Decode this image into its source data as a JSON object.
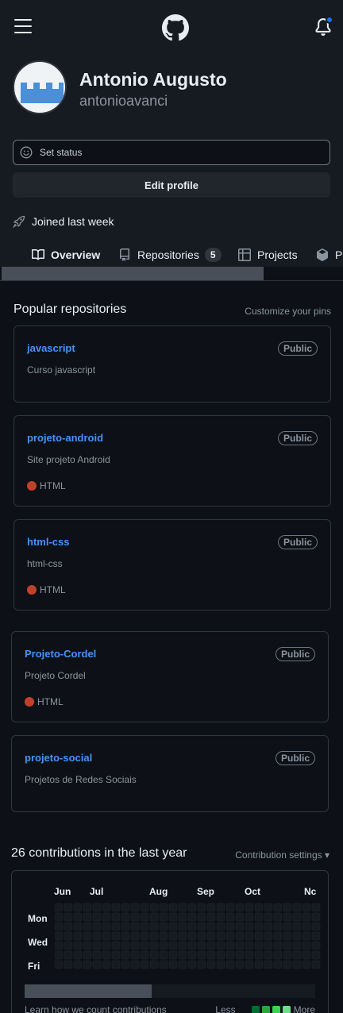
{
  "header": {
    "logo_icon": "github-mark-icon",
    "menu_icon": "hamburger-icon",
    "notification_icon": "bell-icon"
  },
  "profile": {
    "name": "Antonio Augusto",
    "login": "antonioavanci",
    "set_status": "Set status",
    "edit_profile": "Edit profile",
    "joined": "Joined last week"
  },
  "tabs": [
    {
      "label": "Overview",
      "icon": "book-icon",
      "active": true
    },
    {
      "label": "Repositories",
      "icon": "repo-icon",
      "count": "5"
    },
    {
      "label": "Projects",
      "icon": "table-icon"
    },
    {
      "label": "Pa",
      "icon": "package-icon"
    }
  ],
  "popular": {
    "title": "Popular repositories",
    "customize": "Customize your pins",
    "repos": [
      {
        "name": "javascript",
        "badge": "Public",
        "description": "Curso javascript"
      },
      {
        "name": "projeto-android",
        "badge": "Public",
        "description": "Site projeto Android",
        "language": "HTML",
        "language_color": "#e34c26"
      },
      {
        "name": "html-css",
        "badge": "Public",
        "description": "html-css",
        "language": "HTML",
        "language_color": "#e34c26"
      },
      {
        "name": "Projeto-Cordel",
        "badge": "Public",
        "description": "Projeto Cordel",
        "language": "HTML",
        "language_color": "#e34c26"
      },
      {
        "name": "projeto-social",
        "badge": "Public",
        "description": "Projetos de Redes Sociais"
      }
    ]
  },
  "contributions": {
    "title": "26 contributions in the last year",
    "settings": "Contribution settings ▾",
    "months": [
      "Jun",
      "Jul",
      "Aug",
      "Sep",
      "Oct",
      "Nc"
    ],
    "days": [
      "Mon",
      "Wed",
      "Fri"
    ],
    "learn": "Learn how we count contributions",
    "less": "Less",
    "more": "More",
    "legend_colors": [
      "#161b22",
      "#0e4429",
      "#006d32",
      "#26a641",
      "#39d353"
    ]
  }
}
